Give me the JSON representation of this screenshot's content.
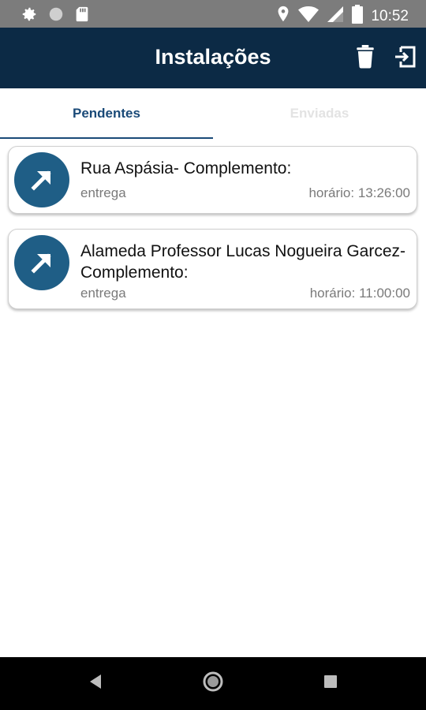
{
  "status_bar": {
    "time": "10:52",
    "icons": [
      "gear-icon",
      "circle-icon",
      "sd-card-icon",
      "location-icon",
      "wifi-icon",
      "signal-icon",
      "battery-icon"
    ]
  },
  "app_bar": {
    "title": "Instalações",
    "actions": [
      "trash-icon",
      "logout-icon"
    ],
    "background_color": "#0c2a45"
  },
  "tabs": [
    {
      "label": "Pendentes",
      "active": true
    },
    {
      "label": "Enviadas",
      "active": false
    }
  ],
  "items": [
    {
      "address": "Rua Aspásia- Complemento:",
      "type": "entrega",
      "time": "horário: 13:26:00"
    },
    {
      "address": "Alameda Professor Lucas Nogueira Garcez- Complemento:",
      "type": "entrega",
      "time": "horário: 11:00:00"
    }
  ],
  "colors": {
    "accent": "#1a4a78",
    "icon_circle": "#1f5e86"
  }
}
